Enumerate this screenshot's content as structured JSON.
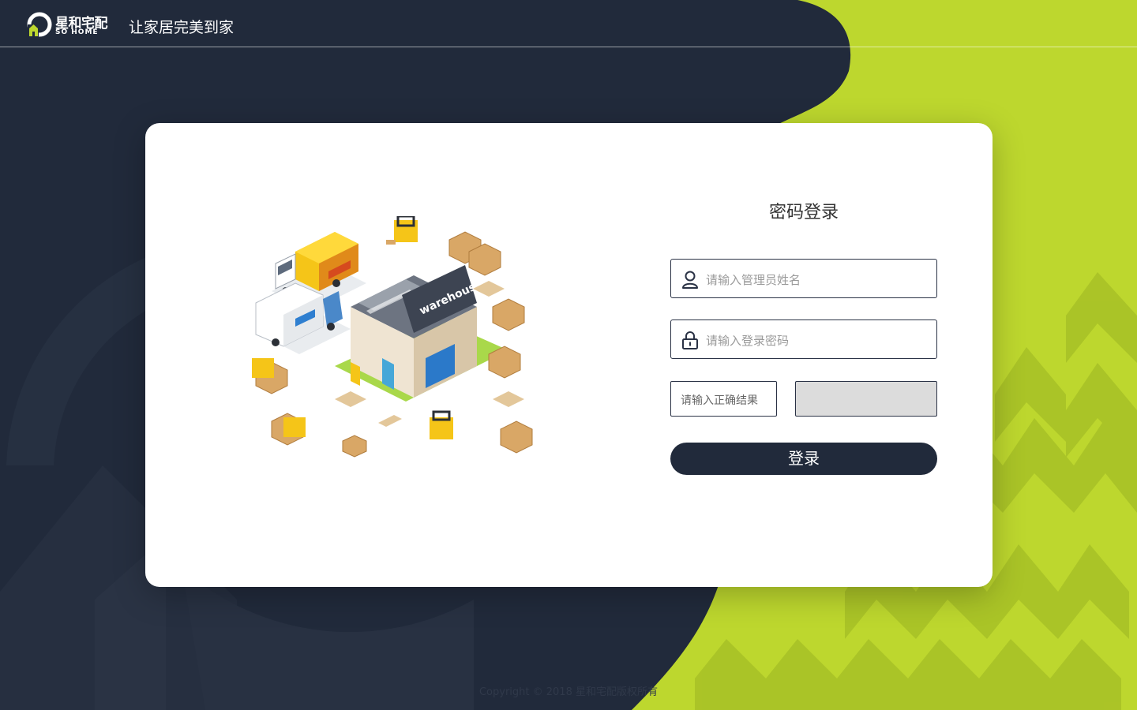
{
  "colors": {
    "navy": "#212a3b",
    "lime": "#bdd72e",
    "card": "#ffffff",
    "captcha_bg": "#dcdcdc"
  },
  "header": {
    "logo": {
      "brand_cn": "星和宅配",
      "brand_en": "SO HOME",
      "icon": "sohome-logo-icon"
    },
    "slogan": "让家居完美到家"
  },
  "login": {
    "title": "密码登录",
    "username": {
      "placeholder": "请输入管理员姓名",
      "icon": "user-icon"
    },
    "password": {
      "placeholder": "请输入登录密码",
      "icon": "lock-icon"
    },
    "captcha": {
      "placeholder": "请输入正确结果"
    },
    "submit_label": "登录"
  },
  "illustration": {
    "sign_text": "warehouse",
    "icon": "warehouse-logistics-illustration"
  },
  "footer": {
    "copyright": "Copyright © 2018 星和宅配版权所有"
  }
}
